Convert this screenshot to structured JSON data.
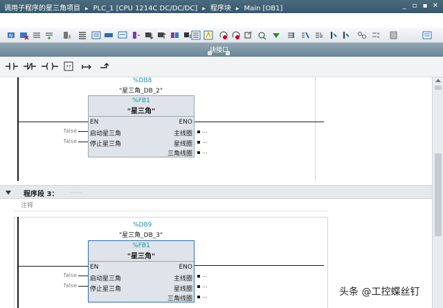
{
  "titlebar": {
    "crumbs": [
      "调用子程序的星三角项目",
      "PLC_1 [CPU 1214C DC/DC/DC]",
      "程序块",
      "Main [OB1]"
    ],
    "separator": "▸",
    "controls": [
      "_",
      "▫",
      "▪",
      "✕"
    ]
  },
  "iface": {
    "label": "块接口"
  },
  "networks": [
    {
      "db_addr": "%DB8",
      "db_name": "\"星三角_DB_2\"",
      "fb_addr": "%FB1",
      "fb_name": "\"星三角\"",
      "in_pins": [
        "EN",
        "启动星三角",
        "停止星三角"
      ],
      "out_pins": [
        "ENO",
        "主线圈",
        "星线圈",
        "三角线圈"
      ],
      "false_label": "false",
      "dots": "..."
    },
    {
      "db_addr": "%DB9",
      "db_name": "\"星三角_DB_3\"",
      "fb_addr": "%FB1",
      "fb_name": "\"星三角\"",
      "in_pins": [
        "EN",
        "启动星三角",
        "停止星三角"
      ],
      "out_pins": [
        "ENO",
        "主线圈",
        "星线圈",
        "三角线圈"
      ],
      "false_label": "false",
      "dots": "..."
    }
  ],
  "section": {
    "title": "程序段 3：",
    "title_suffix": "......",
    "comment": "注释"
  },
  "watermark": "头条 @工控蝶丝钉",
  "colors": {
    "titlebar": "#3f6072",
    "accent_teal": "#1a9999",
    "fb_fill": "#dfe3ea",
    "selected_border": "#2b6db5"
  }
}
